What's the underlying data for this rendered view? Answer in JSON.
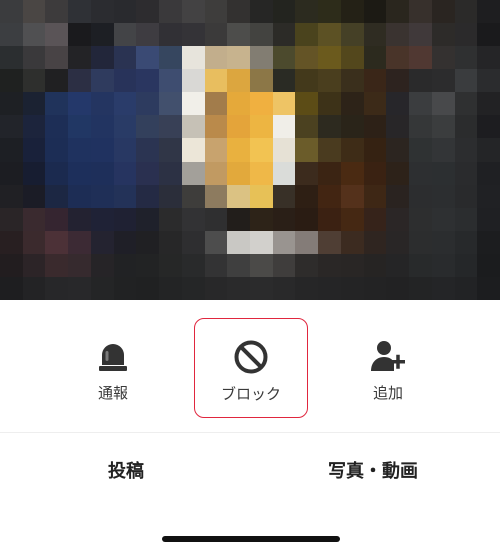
{
  "actions": [
    {
      "label": "通報",
      "icon": "alarm-bell-icon"
    },
    {
      "label": "ブロック",
      "icon": "block-icon"
    },
    {
      "label": "追加",
      "icon": "add-friend-icon"
    }
  ],
  "tabs": [
    {
      "label": "投稿"
    },
    {
      "label": "写真・動画"
    }
  ],
  "colors": {
    "highlight_border": "#e0263e",
    "icon": "#333333"
  },
  "header_pixels": [
    "#3b3c3e",
    "#4a4644",
    "#3d3b3c",
    "#2f3136",
    "#2b2c30",
    "#292a2e",
    "#2d2c2f",
    "#3a393b",
    "#434243",
    "#3e3d3c",
    "#333130",
    "#262625",
    "#23241f",
    "#2c2b1f",
    "#2d2c1a",
    "#242116",
    "#1c1a14",
    "#2a261e",
    "#37302c",
    "#2a2521",
    "#2b2a29",
    "#1e1e20",
    "#3c3e41",
    "#505052",
    "#5a5457",
    "#1a1a1d",
    "#1d1f24",
    "#434447",
    "#3e3c41",
    "#313035",
    "#343337",
    "#3b3a3a",
    "#4d4d4b",
    "#434340",
    "#2c2b27",
    "#4a431d",
    "#5c5124",
    "#454026",
    "#2f2c22",
    "#3a3330",
    "#40393a",
    "#2d2b29",
    "#2b2a2b",
    "#1a1a1c",
    "#2b2e30",
    "#3a393b",
    "#484345",
    "#232326",
    "#22263a",
    "#2a3352",
    "#3a4a74",
    "#36465f",
    "#e7e4dc",
    "#c2ae8c",
    "#c7b38e",
    "#827d72",
    "#4c4a2d",
    "#645426",
    "#6b5a1d",
    "#53471c",
    "#2c2a1e",
    "#493429",
    "#503832",
    "#343130",
    "#2f3031",
    "#252527",
    "#1f2120",
    "#2e2f2d",
    "#202022",
    "#2c2f44",
    "#2f3b5e",
    "#28335a",
    "#2a3660",
    "#3e4d70",
    "#d9d8d5",
    "#e8be5f",
    "#dca63f",
    "#8c7747",
    "#2a2b24",
    "#43391b",
    "#4a3e1e",
    "#3a2f1c",
    "#3a2618",
    "#2d231f",
    "#2a2a2b",
    "#2c2c2d",
    "#3a3c3e",
    "#2b2c2e",
    "#1e2024",
    "#1b2232",
    "#20335b",
    "#24386a",
    "#243561",
    "#2a3c6a",
    "#2d3b5f",
    "#42506d",
    "#f1efe9",
    "#a27c4b",
    "#e5a93a",
    "#f0b040",
    "#eec465",
    "#5c4c16",
    "#3d3218",
    "#2d2318",
    "#3c2a18",
    "#27262a",
    "#3b3d3f",
    "#48494b",
    "#2f3031",
    "#222224",
    "#22242a",
    "#1c243c",
    "#1d2e56",
    "#213764",
    "#223461",
    "#293b66",
    "#33405c",
    "#384056",
    "#c6c1b6",
    "#ba8a4b",
    "#e4a43a",
    "#edb542",
    "#f0eee8",
    "#4b4120",
    "#2d2a1f",
    "#2a2419",
    "#2d2117",
    "#282628",
    "#353738",
    "#3b3d3e",
    "#2b2c2d",
    "#1d1d20",
    "#1d1f24",
    "#19213a",
    "#1c2d55",
    "#1f325f",
    "#203260",
    "#283863",
    "#2b3452",
    "#303647",
    "#ece6d8",
    "#c8a36e",
    "#e9b13f",
    "#f2c352",
    "#e6e1d5",
    "#6b5c2a",
    "#4a3b1f",
    "#3e2c17",
    "#352212",
    "#2c2520",
    "#2f3233",
    "#333537",
    "#2c2d2f",
    "#242527",
    "#1c1d22",
    "#171d31",
    "#1b2a4f",
    "#1d2f5b",
    "#1e2f5a",
    "#263460",
    "#2a3050",
    "#2c3144",
    "#a3a09a",
    "#c19a62",
    "#e2a93c",
    "#efb848",
    "#dadcd9",
    "#3c2b1d",
    "#3b2413",
    "#4a2a12",
    "#3a2212",
    "#2d2219",
    "#2d2f31",
    "#2c2f31",
    "#2a2b2d",
    "#1f2023",
    "#202024",
    "#1b1c26",
    "#1c2743",
    "#1d2d55",
    "#1f2f57",
    "#233258",
    "#242a44",
    "#2b2e3a",
    "#3e3d3b",
    "#8d7b5f",
    "#dbc283",
    "#e7c157",
    "#383027",
    "#2e1f14",
    "#422512",
    "#54311b",
    "#3e2715",
    "#2a2320",
    "#2c2d2f",
    "#2c2e30",
    "#292a2c",
    "#202124",
    "#2a2527",
    "#3a2a2f",
    "#352530",
    "#232231",
    "#1f2236",
    "#1f2133",
    "#1f212b",
    "#2b2b2c",
    "#323234",
    "#2f2f30",
    "#221e1b",
    "#2d2318",
    "#2a1f17",
    "#2a1c13",
    "#3b2112",
    "#452813",
    "#36231a",
    "#2b2626",
    "#2d2e2f",
    "#2e3032",
    "#2b2d2f",
    "#1f2023",
    "#281f21",
    "#3b2a2d",
    "#4c3137",
    "#3c2a34",
    "#242330",
    "#1f1f27",
    "#202023",
    "#272728",
    "#2e2e30",
    "#4d4d4d",
    "#c9c8c4",
    "#d2d0cc",
    "#999490",
    "#847c78",
    "#4f3e34",
    "#3c2b20",
    "#2f2520",
    "#292626",
    "#2c2d2e",
    "#2b2d2f",
    "#27292b",
    "#1c1d1f",
    "#221d1f",
    "#2c2427",
    "#3a2a2d",
    "#362a2e",
    "#262427",
    "#212224",
    "#222324",
    "#262727",
    "#292a2b",
    "#333334",
    "#3f3f3f",
    "#4b4a48",
    "#3f3d3c",
    "#2e2c2b",
    "#2a2726",
    "#292625",
    "#262423",
    "#252526",
    "#282a2b",
    "#292b2d",
    "#252729",
    "#1b1c1e",
    "#1e1e20",
    "#232325",
    "#272729",
    "#28282a",
    "#242526",
    "#212223",
    "#202122",
    "#232425",
    "#252627",
    "#282829",
    "#2a2a2b",
    "#2b2b2c",
    "#29292a",
    "#262627",
    "#252526",
    "#242425",
    "#232324",
    "#222223",
    "#232425",
    "#242527",
    "#222325",
    "#1c1d1f"
  ]
}
